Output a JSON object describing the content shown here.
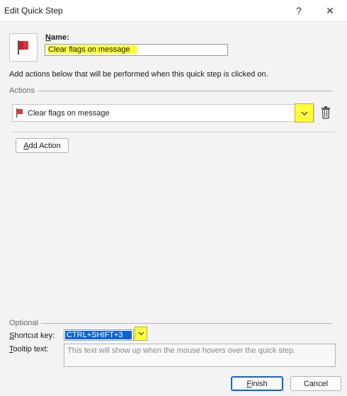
{
  "window": {
    "title": "Edit Quick Step",
    "help_label": "?",
    "close_label": "✕"
  },
  "name_section": {
    "label_accel": "N",
    "label_rest": "ame:",
    "value": "Clear flags on message"
  },
  "description": "Add actions below that will be performed when this quick step is clicked on.",
  "actions": {
    "group_label": "Actions",
    "items": [
      {
        "label": "Clear flags on message",
        "icon": "red-flag-icon"
      }
    ],
    "add_action_accel": "A",
    "add_action_rest": "dd Action"
  },
  "optional": {
    "group_label": "Optional",
    "shortcut_label_accel": "S",
    "shortcut_label_rest": "hortcut key:",
    "shortcut_value": "CTRL+SHIFT+3",
    "tooltip_label_accel": "T",
    "tooltip_label_rest": "ooltip text:",
    "tooltip_placeholder": "This text will show up when the mouse hovers over the quick step."
  },
  "buttons": {
    "finish_accel": "F",
    "finish_rest": "inish",
    "cancel_label": "Cancel"
  },
  "colors": {
    "highlight": "#ffff3a",
    "selection": "#0a64d6",
    "flag": "#e0343c"
  }
}
